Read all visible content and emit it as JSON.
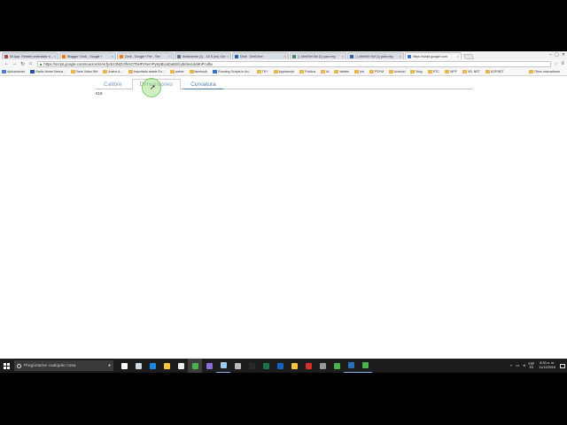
{
  "browser": {
    "tabs": [
      {
        "label": "Mi App: Gestion ordenador e...",
        "color": "#b04040",
        "active": false
      },
      {
        "label": "Blogger: Dedi - Google +",
        "color": "#f57c00",
        "active": false
      },
      {
        "label": "Dedi - Google+ Per - Ser",
        "color": "#f57c00",
        "active": false
      },
      {
        "label": "Analizando (1) - 1A S (en) Gra",
        "color": "#6a6a9c",
        "active": false
      },
      {
        "label": "Dedi - OneDrive",
        "color": "#1e5fb4",
        "active": false
      },
      {
        "label": "( ) MedSel Sel (1) para reg",
        "color": "#3d8a5a",
        "active": false
      },
      {
        "label": "( ) MedSel Sel (1) para reg",
        "color": "#2c5fa8",
        "active": false
      },
      {
        "label": "https://script.google.com",
        "color": "#3a6fc4",
        "active": true
      }
    ],
    "window_controls": {
      "minimize": "–",
      "maximize": "▢",
      "close": "✕"
    },
    "toolbar": {
      "back": "←",
      "forward": "→",
      "reload": "↻",
      "home": "⌂",
      "url": "https://script.google.com/macros/s/AKfycbz3NZIJlfVsOTbHFt/semPyKpBUaDuBSlcyb/dev/deMnPcvlbv"
    },
    "bookmarks": [
      {
        "label": "Aplicaciones",
        "color": "#4a7fd4"
      },
      {
        "label": "Radio Home Nexus -",
        "color": "#2255aa"
      },
      {
        "label": "Save Video We",
        "color": "#e8b84a"
      },
      {
        "label": "Anime A...",
        "color": "#e8b84a"
      },
      {
        "label": "Importado desde Ex...",
        "color": "#e8b84a"
      },
      {
        "label": "anime",
        "color": "#e8b84a"
      },
      {
        "label": "facebook",
        "color": "#e8b84a"
      },
      {
        "label": "Running Scripts in Ad...",
        "color": "#3a6fc4"
      },
      {
        "label": "TKY",
        "color": "#e8b84a"
      },
      {
        "label": "Applescript",
        "color": "#e8b84a"
      },
      {
        "label": "Política",
        "color": "#e8b84a"
      },
      {
        "label": "IA",
        "color": "#e8b84a"
      },
      {
        "label": "tablets",
        "color": "#e8b84a"
      },
      {
        "label": "job",
        "color": "#e8b84a"
      },
      {
        "label": "PSYM",
        "color": "#e8b84a"
      },
      {
        "label": "Android",
        "color": "#e8b84a"
      },
      {
        "label": "Blog",
        "color": "#e8b84a"
      },
      {
        "label": "RTC",
        "color": "#e8b84a"
      },
      {
        "label": "WPF",
        "color": "#e8b84a"
      },
      {
        "label": "VB .NET",
        "color": "#e8b84a"
      },
      {
        "label": "ASP.NET",
        "color": "#e8b84a"
      }
    ],
    "other_bookmarks": "Otros marcadores"
  },
  "page": {
    "tabs": [
      {
        "label": "Calibre",
        "state": "normal"
      },
      {
        "label": "Dimensiones",
        "state": "active"
      },
      {
        "label": "Curvatura",
        "state": "selected"
      }
    ],
    "label": "€18"
  },
  "taskbar": {
    "search_placeholder": "Pregúntame cualquier cosa",
    "apps": [
      {
        "name": "task-view-icon",
        "color": "#ffffff",
        "state": ""
      },
      {
        "name": "store-icon",
        "color": "#cfd8e3",
        "state": ""
      },
      {
        "name": "edge-icon",
        "color": "#1e88e5",
        "state": ""
      },
      {
        "name": "file-explorer-icon",
        "color": "#f4c542",
        "state": ""
      },
      {
        "name": "store-bag-icon",
        "color": "#eeeeee",
        "state": ""
      },
      {
        "name": "chrome-icon",
        "color": "#4caf50",
        "state": "current"
      },
      {
        "name": "visual-studio-icon",
        "color": "#8e6bd4",
        "state": ""
      },
      {
        "name": "photos-icon",
        "color": "#9fc8e8",
        "state": "running"
      },
      {
        "name": "app-icon",
        "color": "#bbbbbb",
        "state": ""
      },
      {
        "name": "onenote-icon",
        "color": "#2a2a2a",
        "state": ""
      },
      {
        "name": "excel-icon",
        "color": "#1e7145",
        "state": ""
      },
      {
        "name": "outlook-icon",
        "color": "#1565c0",
        "state": ""
      },
      {
        "name": "folder-icon",
        "color": "#f4c542",
        "state": ""
      },
      {
        "name": "filezilla-icon",
        "color": "#d32f2f",
        "state": ""
      },
      {
        "name": "tools-icon",
        "color": "#999999",
        "state": ""
      },
      {
        "name": "app-green-icon",
        "color": "#4caf50",
        "state": ""
      },
      {
        "name": "network-icon",
        "color": "#2a6fb8",
        "state": "running"
      },
      {
        "name": "chrome-alt-icon",
        "color": "#4caf50",
        "state": "running"
      }
    ],
    "tray": {
      "chevron": "^",
      "lang_top": "ESP",
      "lang_bottom": "ES",
      "time": "8:33 a. m.",
      "date": "11/12/2015"
    }
  }
}
